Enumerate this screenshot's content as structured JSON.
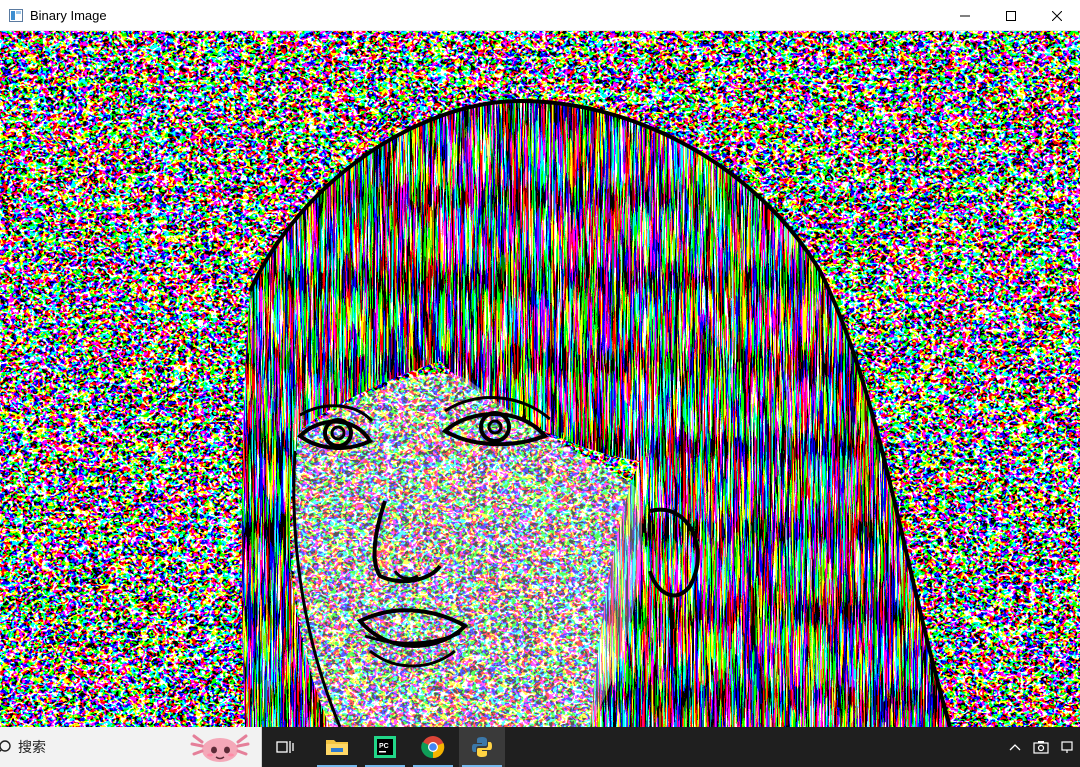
{
  "window": {
    "title": "Binary Image",
    "controls": [
      "minimize",
      "maximize",
      "close"
    ]
  },
  "canvas": {
    "content": "binary-edge-image"
  },
  "taskbar": {
    "search_label": "搜索",
    "apps": [
      {
        "name": "task-view",
        "icon": "task-view-icon"
      },
      {
        "name": "file-explorer",
        "icon": "folder-icon"
      },
      {
        "name": "pycharm",
        "icon": "pycharm-icon"
      },
      {
        "name": "chrome",
        "icon": "chrome-icon"
      },
      {
        "name": "python",
        "icon": "python-icon",
        "active": true
      }
    ],
    "tray": [
      "chevron-up-icon",
      "camera-icon",
      "network-icon"
    ]
  },
  "colors": {
    "taskbar_bg": "#1f1f1f",
    "active_underline": "#76b9ed",
    "titlebar_bg": "#ffffff"
  }
}
